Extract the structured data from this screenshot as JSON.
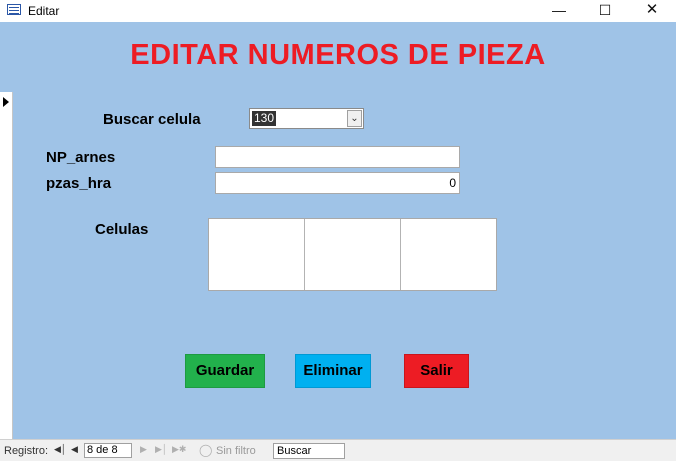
{
  "window": {
    "title": "Editar",
    "minimize_glyph": "—",
    "maximize_glyph": "☐",
    "close_glyph": "✕"
  },
  "form": {
    "heading": "EDITAR NUMEROS DE PIEZA",
    "buscar_label": "Buscar celula",
    "buscar_value": "130",
    "np_arnes_label": "NP_arnes",
    "np_arnes_value": "",
    "pzas_hra_label": "pzas_hra",
    "pzas_hra_value": "0",
    "celulas_label": "Celulas",
    "buttons": {
      "save": "Guardar",
      "delete": "Eliminar",
      "exit": "Salir"
    }
  },
  "statusbar": {
    "record_label": "Registro:",
    "record_position": "8 de 8",
    "filter_label": "Sin filtro",
    "search_text": "Buscar"
  },
  "colors": {
    "form_background": "#9fc3e7",
    "heading": "#ed1c24",
    "save_button": "#22b14c",
    "delete_button": "#00b0f0",
    "exit_button": "#ed1c24"
  }
}
